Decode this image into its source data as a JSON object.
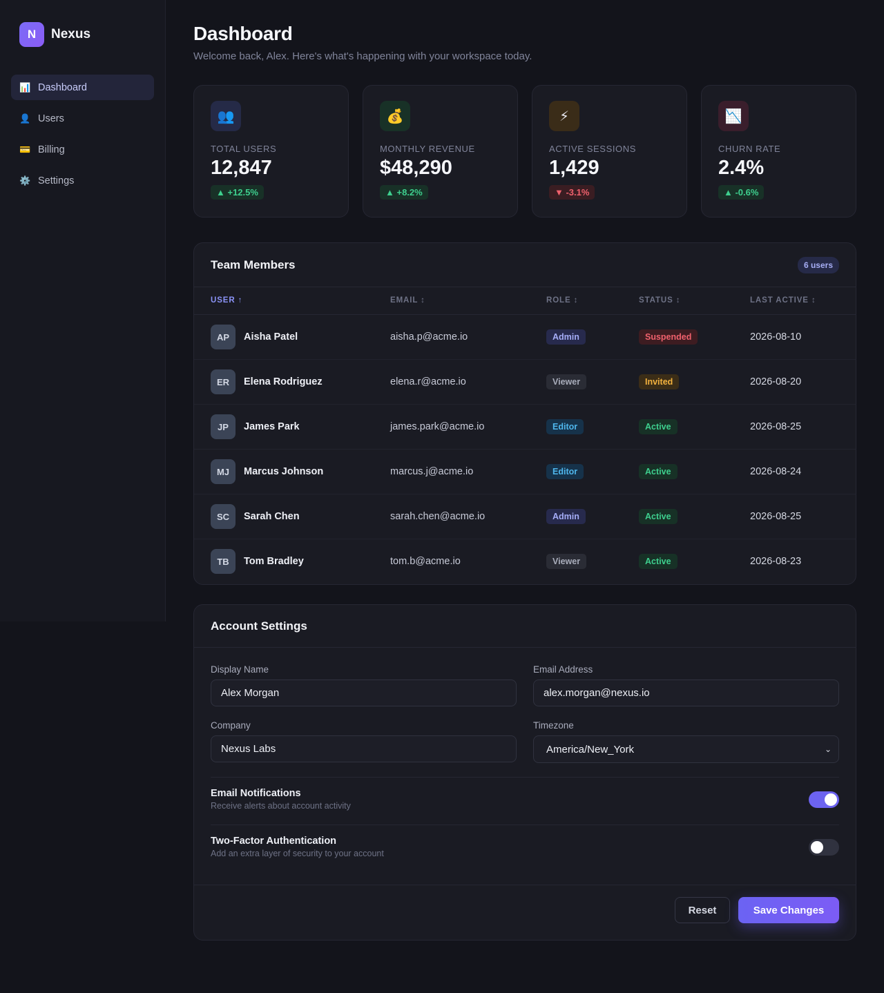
{
  "brand": {
    "logo_letter": "N",
    "name": "Nexus"
  },
  "sidebar": {
    "items": [
      {
        "label": "Dashboard",
        "icon": "📊",
        "icon_name": "chart-icon",
        "active": true
      },
      {
        "label": "Users",
        "icon": "👤",
        "icon_name": "user-icon",
        "active": false
      },
      {
        "label": "Billing",
        "icon": "💳",
        "icon_name": "credit-card-icon",
        "active": false
      },
      {
        "label": "Settings",
        "icon": "⚙️",
        "icon_name": "gear-icon",
        "active": false
      }
    ]
  },
  "header": {
    "title": "Dashboard",
    "subtitle": "Welcome back, Alex. Here's what's happening with your workspace today."
  },
  "stats": [
    {
      "icon": "👥",
      "icon_name": "users-icon",
      "icon_bg": "#252a47",
      "label": "Total Users",
      "value": "12,847",
      "change": "▲ +12.5%",
      "trend": "up"
    },
    {
      "icon": "💰",
      "icon_name": "money-bag-icon",
      "icon_bg": "#183127",
      "label": "Monthly Revenue",
      "value": "$48,290",
      "change": "▲ +8.2%",
      "trend": "up"
    },
    {
      "icon": "⚡",
      "icon_name": "lightning-icon",
      "icon_bg": "#3a2c18",
      "label": "Active Sessions",
      "value": "1,429",
      "change": "▼ -3.1%",
      "trend": "down"
    },
    {
      "icon": "📉",
      "icon_name": "chart-down-icon",
      "icon_bg": "#3a1e2c",
      "label": "Churn Rate",
      "value": "2.4%",
      "change": "▲ -0.6%",
      "trend": "up"
    }
  ],
  "team": {
    "title": "Team Members",
    "count": "6 users",
    "columns": [
      "USER ↑",
      "EMAIL ↕",
      "ROLE ↕",
      "STATUS ↕",
      "LAST ACTIVE ↕"
    ],
    "rows": [
      {
        "initials": "AP",
        "name": "Aisha Patel",
        "email": "aisha.p@acme.io",
        "role": "Admin",
        "status": "Suspended",
        "last_active": "2026-08-10"
      },
      {
        "initials": "ER",
        "name": "Elena Rodriguez",
        "email": "elena.r@acme.io",
        "role": "Viewer",
        "status": "Invited",
        "last_active": "2026-08-20"
      },
      {
        "initials": "JP",
        "name": "James Park",
        "email": "james.park@acme.io",
        "role": "Editor",
        "status": "Active",
        "last_active": "2026-08-25"
      },
      {
        "initials": "MJ",
        "name": "Marcus Johnson",
        "email": "marcus.j@acme.io",
        "role": "Editor",
        "status": "Active",
        "last_active": "2026-08-24"
      },
      {
        "initials": "SC",
        "name": "Sarah Chen",
        "email": "sarah.chen@acme.io",
        "role": "Admin",
        "status": "Active",
        "last_active": "2026-08-25"
      },
      {
        "initials": "TB",
        "name": "Tom Bradley",
        "email": "tom.b@acme.io",
        "role": "Viewer",
        "status": "Active",
        "last_active": "2026-08-23"
      }
    ]
  },
  "settings": {
    "title": "Account Settings",
    "display_name_label": "Display Name",
    "display_name_value": "Alex Morgan",
    "email_label": "Email Address",
    "email_value": "alex.morgan@nexus.io",
    "company_label": "Company",
    "company_value": "Nexus Labs",
    "timezone_label": "Timezone",
    "timezone_value": "America/New_York",
    "email_notifications_title": "Email Notifications",
    "email_notifications_desc": "Receive alerts about account activity",
    "email_notifications_on": true,
    "two_factor_title": "Two-Factor Authentication",
    "two_factor_desc": "Add an extra layer of security to your account",
    "two_factor_on": false,
    "reset_label": "Reset",
    "save_label": "Save Changes"
  },
  "colors": {
    "accent": "#6c63f0",
    "positive": "#3ecf8e",
    "negative": "#f0616d",
    "warning": "#f2b13e"
  }
}
